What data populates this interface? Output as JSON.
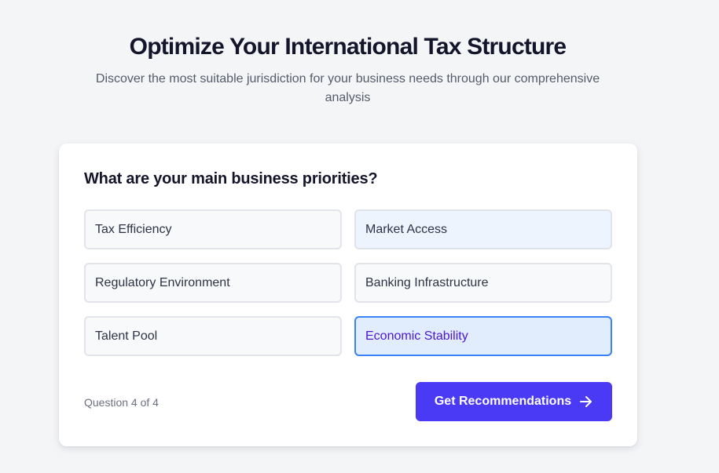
{
  "header": {
    "title": "Optimize Your International Tax Structure",
    "subtitle": "Discover the most suitable jurisdiction for your business needs through our comprehensive analysis"
  },
  "card": {
    "question": "What are your main business priorities?",
    "options": [
      {
        "label": "Tax Efficiency",
        "state": "default"
      },
      {
        "label": "Market Access",
        "state": "hover"
      },
      {
        "label": "Regulatory Environment",
        "state": "default"
      },
      {
        "label": "Banking Infrastructure",
        "state": "default"
      },
      {
        "label": "Talent Pool",
        "state": "default"
      },
      {
        "label": "Economic Stability",
        "state": "selected"
      }
    ],
    "progress": "Question 4 of 4",
    "cta_label": "Get Recommendations",
    "cta_icon": "arrow-right-icon"
  },
  "colors": {
    "accent": "#4a3af5",
    "selected_border": "#3b82f6",
    "selected_bg": "#e1edfd",
    "selected_text": "#4b16d4"
  }
}
